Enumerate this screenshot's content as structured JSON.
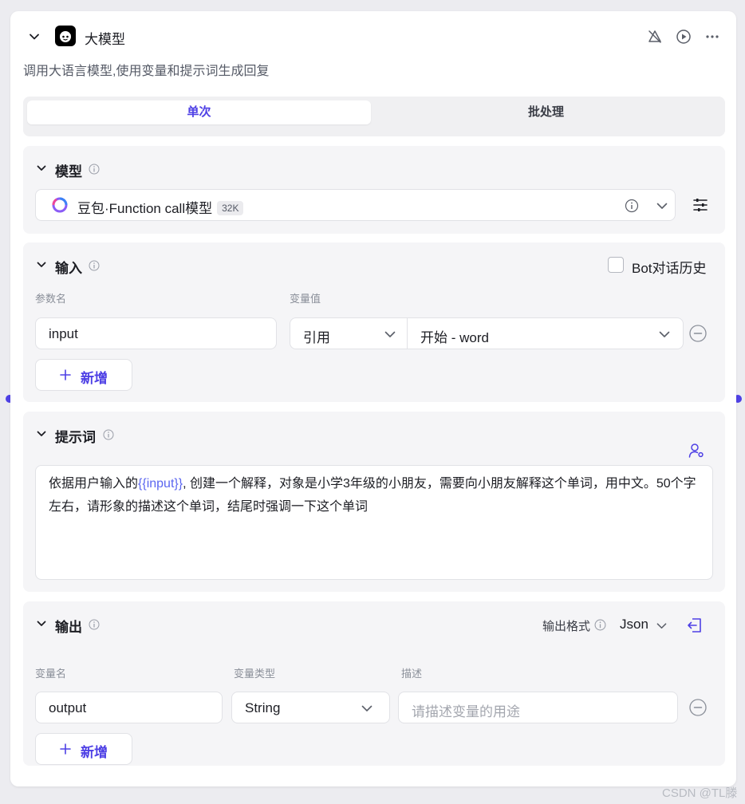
{
  "node": {
    "title": "大模型",
    "description": "调用大语言模型,使用变量和提示词生成回复"
  },
  "mode_tabs": [
    {
      "label": "单次",
      "active": true
    },
    {
      "label": "批处理",
      "active": false
    }
  ],
  "model_section": {
    "title": "模型",
    "model_name": "豆包·Function call模型",
    "context_badge": "32K"
  },
  "input_section": {
    "title": "输入",
    "bot_history_label": "Bot对话历史",
    "bot_history_checked": false,
    "col_param_name": "参数名",
    "col_var_value": "变量值",
    "rows": [
      {
        "name": "input",
        "source": "引用",
        "value": "开始 - word"
      }
    ],
    "add_label": "新增"
  },
  "prompt_section": {
    "title": "提示词",
    "text_before": "依据用户输入的",
    "variable": "{{input}}",
    "text_after": ", 创建一个解释，对象是小学3年级的小朋友，需要向小朋友解释这个单词，用中文。50个字左右，请形象的描述这个单词，结尾时强调一下这个单词"
  },
  "output_section": {
    "title": "输出",
    "format_label": "输出格式",
    "format_value": "Json",
    "col_var_name": "变量名",
    "col_var_type": "变量类型",
    "col_desc": "描述",
    "rows": [
      {
        "name": "output",
        "type": "String",
        "desc_placeholder": "请描述变量的用途"
      }
    ],
    "add_label": "新增"
  },
  "watermark": "CSDN @TL滕",
  "colors": {
    "accent": "#4e40e5",
    "section_bg": "#f5f5f7",
    "variable": "#5b66f0"
  },
  "icons": [
    "chevron-down-icon",
    "app-logo-icon",
    "bug-off-icon",
    "play-circle-icon",
    "more-icon",
    "info-icon",
    "model-logo-icon",
    "sliders-icon",
    "plus-icon",
    "minus-circle-icon",
    "user-settings-icon",
    "output-panel-icon"
  ]
}
